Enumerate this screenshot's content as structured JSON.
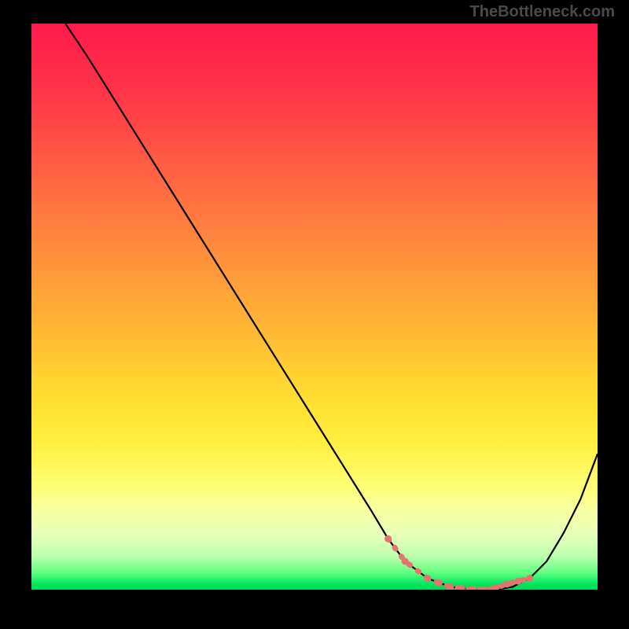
{
  "watermark": "TheBottleneck.com",
  "chart_data": {
    "type": "line",
    "title": "",
    "xlabel": "",
    "ylabel": "",
    "xlim": [
      0,
      100
    ],
    "ylim": [
      0,
      100
    ],
    "grid": false,
    "legend": false,
    "series": [
      {
        "name": "bottleneck-curve",
        "x": [
          6,
          10,
          15,
          20,
          25,
          30,
          35,
          40,
          45,
          50,
          55,
          60,
          63,
          66,
          70,
          74,
          78,
          82,
          85,
          88,
          91,
          94,
          97,
          100
        ],
        "y": [
          100,
          94,
          86,
          78,
          70,
          62,
          54,
          46,
          38,
          30,
          22,
          14,
          9,
          5,
          2,
          0.5,
          0,
          0,
          0.5,
          2,
          5,
          10,
          16,
          24
        ],
        "color": "#000000"
      }
    ],
    "markers": {
      "name": "highlighted-range",
      "color": "#e6736e",
      "points_x": [
        63,
        66,
        70,
        72,
        74,
        76,
        78,
        80,
        82,
        84,
        86,
        88
      ],
      "points_y": [
        9,
        5,
        2,
        1.2,
        0.5,
        0.2,
        0,
        0,
        0.3,
        1,
        1.5,
        2
      ]
    },
    "background": {
      "type": "vertical-gradient",
      "stops": [
        {
          "pos": 0,
          "color": "#ff1a4d"
        },
        {
          "pos": 50,
          "color": "#ffb536"
        },
        {
          "pos": 80,
          "color": "#fdff70"
        },
        {
          "pos": 100,
          "color": "#00d850"
        }
      ]
    }
  }
}
